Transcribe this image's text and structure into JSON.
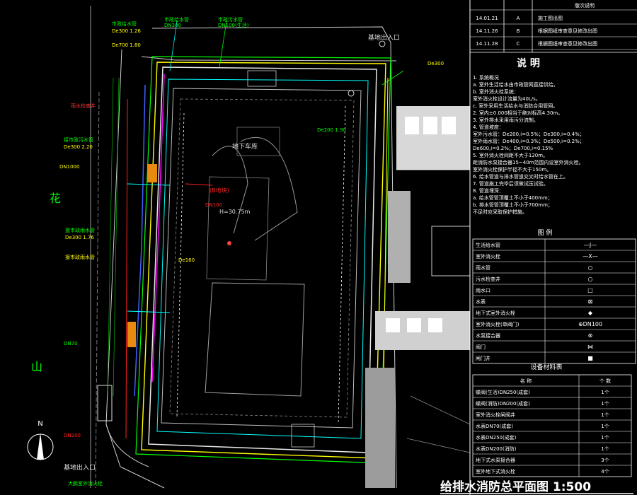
{
  "revision_table": {
    "header": [
      "",
      "",
      "版次说明"
    ],
    "rows": [
      {
        "date": "14.01.21",
        "ver": "A",
        "desc": "施工图出图"
      },
      {
        "date": "14.11.26",
        "ver": "B",
        "desc": "根据图纸审查意见修改出图"
      },
      {
        "date": "14.11.28",
        "ver": "C",
        "desc": "根据图纸审查意见修改出图"
      }
    ]
  },
  "notes": {
    "title": "说 明",
    "lines": [
      "1. 系统概况",
      "  a. 室外生活给水由市政管网直接供给。",
      "  b. 室外消火栓系统：",
      "  室外消火栓设计流量为40L/s。",
      "  c. 室外采用生活给水与消防合用管网。",
      "2. 室内±0.000相当于绝对标高4.30m。",
      "3. 室外排水采用雨污分流制。",
      "4. 管道坡度：",
      "  室外污水管：De200,i=0.5%；De300,i=0.4%；",
      "  室外雨水管：De400,i=0.3%；De500,i=0.2%；",
      "  De600,i=0.2%；De700,i=0.15%",
      "5. 室外消火栓间距不大于120m。",
      "  距消防水泵接合器15~40m范围内设室外消火栓。",
      "  室外消火栓保护半径不大于150m。",
      "6. 给水管道与排水管道交叉时给水管在上。",
      "7. 管道施工完毕后须做试压试验。",
      "8. 管道埋深：",
      "  a. 给水管管顶覆土不小于400mm；",
      "  b. 排水管管顶覆土不小于700mm；",
      "  不足时应采取保护措施。"
    ]
  },
  "legend": {
    "title": "图 例",
    "rows": [
      {
        "label": "生活给水管",
        "symbol": "—J—"
      },
      {
        "label": "室外消火栓",
        "symbol": "—X—"
      },
      {
        "label": "雨水管",
        "symbol": "○"
      },
      {
        "label": "污水检查井",
        "symbol": "○"
      },
      {
        "label": "雨水口",
        "symbol": "□"
      },
      {
        "label": "水表",
        "symbol": "⊠"
      },
      {
        "label": "地下式室外消火栓",
        "symbol": "◆"
      },
      {
        "label": "室外消火栓(单阀门)",
        "symbol": "⊕DN100"
      },
      {
        "label": "水泵接合器",
        "symbol": "⊗"
      },
      {
        "label": "阀门",
        "symbol": "⋈"
      },
      {
        "label": "闸门井",
        "symbol": "■"
      }
    ]
  },
  "equipment": {
    "title": "设备材料表",
    "header": [
      "名 称",
      "个 数"
    ],
    "rows": [
      {
        "name": "蝶阀(生活)DN250(成套)",
        "qty": "1个"
      },
      {
        "name": "蝶阀(消防)DN200(成套)",
        "qty": "1个"
      },
      {
        "name": "室外消火栓闸阀井",
        "qty": "1个"
      },
      {
        "name": "水表DN70(成套)",
        "qty": "1个"
      },
      {
        "name": "水表DN250(成套)",
        "qty": "1个"
      },
      {
        "name": "水表DN200(消防)",
        "qty": "1个"
      },
      {
        "name": "地下式水泵接合器",
        "qty": "3个"
      },
      {
        "name": "室外地下式消火栓",
        "qty": "4个"
      }
    ]
  },
  "plan_title": "给排水消防总平面图 1:500",
  "compass": "N",
  "site_labels": {
    "hua": "花",
    "shan": "山",
    "entrance_top": "基地出入口",
    "entrance_bottom": "基地出入口",
    "main_building": "地下车库",
    "pump_room": "(B地块)",
    "height_note": "H=30.75m"
  },
  "pipe_labels": [
    {
      "id": "p1",
      "text": "市政给水管"
    },
    {
      "id": "p2",
      "text": "De300  1.26"
    },
    {
      "id": "p3",
      "text": "De700  1.80"
    },
    {
      "id": "p4",
      "text": "市政给水管"
    },
    {
      "id": "p5",
      "text": "DN300"
    },
    {
      "id": "p6",
      "text": "市政污水管"
    },
    {
      "id": "p7",
      "text": "DN100(生活)"
    },
    {
      "id": "p8",
      "text": "De300"
    },
    {
      "id": "p9",
      "text": "雨水检查井"
    },
    {
      "id": "p10",
      "text": "接市政污水管"
    },
    {
      "id": "p11",
      "text": "De300  2.20"
    },
    {
      "id": "p12",
      "text": "DN1000"
    },
    {
      "id": "p13",
      "text": "接市政雨水管"
    },
    {
      "id": "p14",
      "text": "De300  1.76"
    },
    {
      "id": "p15",
      "text": "接市政雨水管"
    },
    {
      "id": "p16",
      "text": "DN70"
    },
    {
      "id": "p17",
      "text": "DN200"
    },
    {
      "id": "p18",
      "text": "De200  1.90"
    },
    {
      "id": "p19",
      "text": "DN100"
    },
    {
      "id": "p20",
      "text": "De160"
    },
    {
      "id": "p21",
      "text": "大鹏室外消火栓"
    }
  ]
}
